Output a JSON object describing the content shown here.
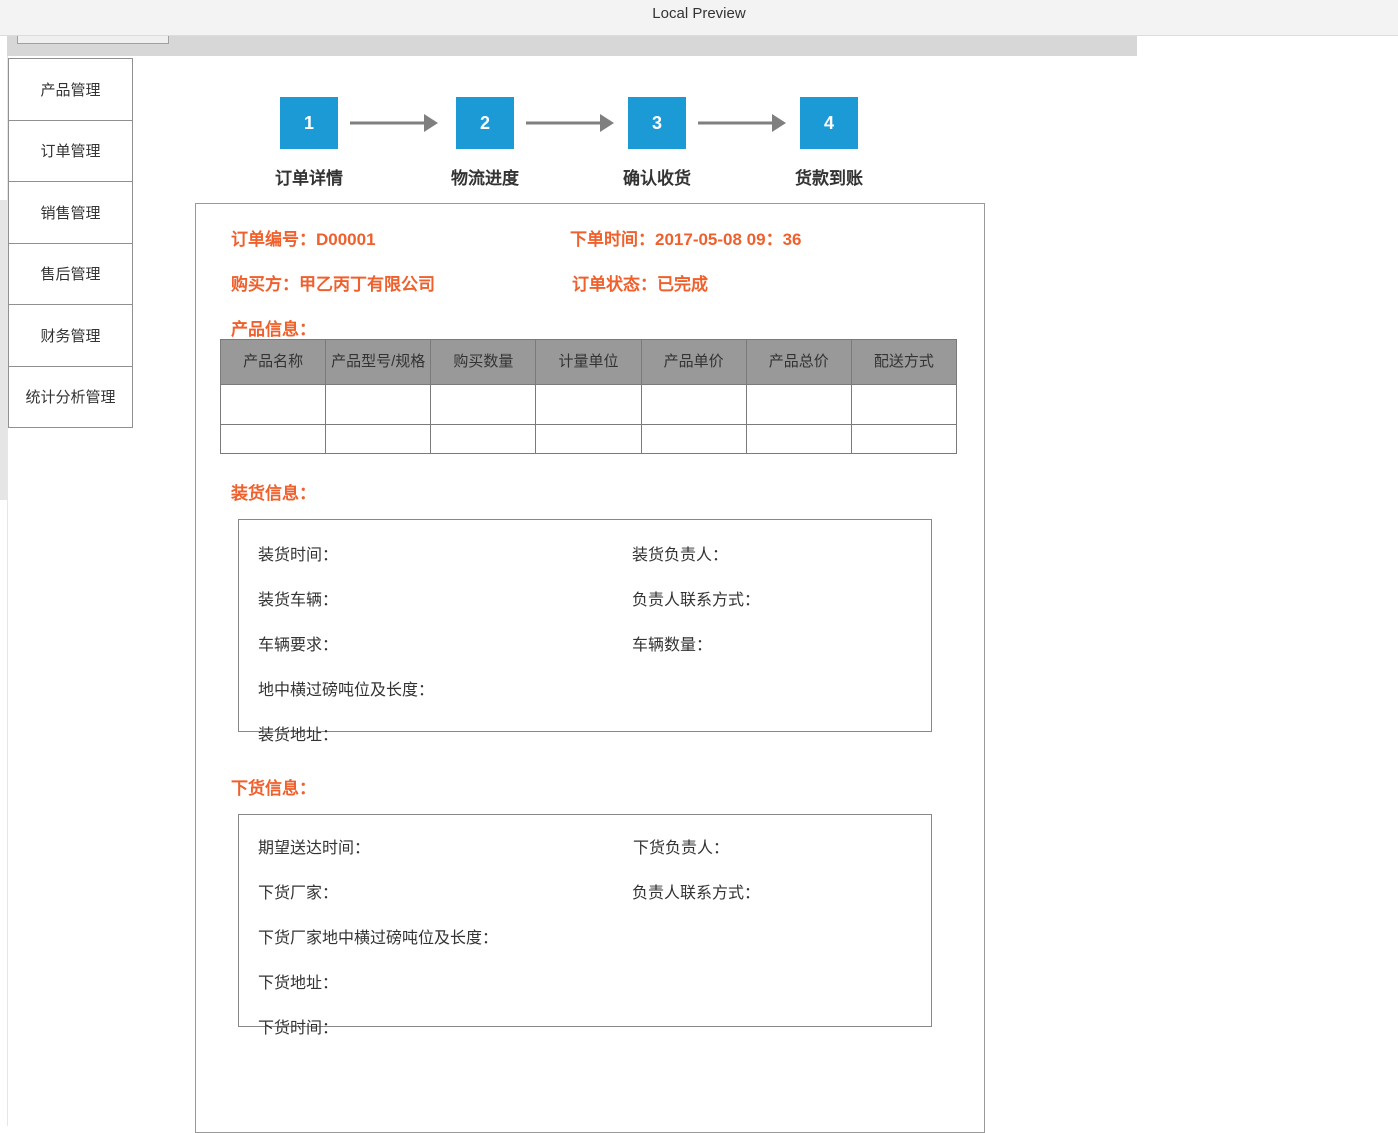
{
  "window": {
    "title": "Local Preview"
  },
  "sidebar": {
    "items": [
      {
        "label": "产品管理"
      },
      {
        "label": "订单管理"
      },
      {
        "label": "销售管理"
      },
      {
        "label": "售后管理"
      },
      {
        "label": "财务管理"
      },
      {
        "label": "统计分析管理"
      }
    ]
  },
  "steps": [
    {
      "number": "1",
      "label": "订单详情"
    },
    {
      "number": "2",
      "label": "物流进度"
    },
    {
      "number": "3",
      "label": "确认收货"
    },
    {
      "number": "4",
      "label": "货款到账"
    }
  ],
  "order": {
    "number": "订单编号：D00001",
    "time": "下单时间：2017-05-08 09：36",
    "buyer": "购买方：甲乙丙丁有限公司",
    "status": "订单状态：已完成"
  },
  "product_section": {
    "title": "产品信息：",
    "columns": [
      "产品名称",
      "产品型号/规格",
      "购买数量",
      "计量单位",
      "产品单价",
      "产品总价",
      "配送方式"
    ]
  },
  "loading": {
    "title": "装货信息：",
    "time": "装货时间：",
    "owner": "装货负责人：",
    "vehicle": "装货车辆：",
    "contact": "负责人联系方式：",
    "requirement": "车辆要求：",
    "count": "车辆数量：",
    "scale": "地中横过磅吨位及长度：",
    "address": "装货地址："
  },
  "unloading": {
    "title": "下货信息：",
    "expected": "期望送达时间：",
    "owner": "下货负责人：",
    "factory": "下货厂家：",
    "contact": "负责人联系方式：",
    "scale": "下货厂家地中横过磅吨位及长度：",
    "address": "下货地址：",
    "time": "下货时间："
  },
  "colors": {
    "accent": "#f0602d",
    "step": "#1b9ad6",
    "table_header": "#999999"
  }
}
